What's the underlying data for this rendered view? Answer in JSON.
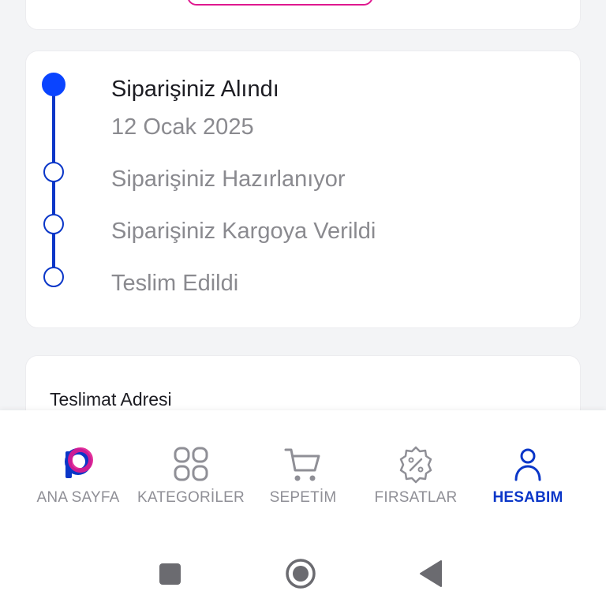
{
  "order_status": {
    "steps": [
      {
        "label": "Siparişiniz Alındı",
        "date": "12 Ocak 2025",
        "active": true
      },
      {
        "label": "Siparişiniz Hazırlanıyor",
        "active": false
      },
      {
        "label": "Siparişiniz Kargoya Verildi",
        "active": false
      },
      {
        "label": "Teslim Edildi",
        "active": false
      }
    ]
  },
  "address": {
    "title": "Teslimat Adresi"
  },
  "bottom_nav": {
    "items": [
      {
        "label": "ANA SAYFA",
        "icon": "brand-logo-icon",
        "active": false
      },
      {
        "label": "KATEGORİLER",
        "icon": "grid-icon",
        "active": false
      },
      {
        "label": "SEPETİM",
        "icon": "cart-icon",
        "active": false
      },
      {
        "label": "FIRSATLAR",
        "icon": "discount-badge-icon",
        "active": false
      },
      {
        "label": "HESABIM",
        "icon": "user-icon",
        "active": true
      }
    ]
  },
  "system_nav": {
    "buttons": [
      "recents-icon",
      "home-icon",
      "back-icon"
    ]
  },
  "colors": {
    "primary": "#0a36c8",
    "active_dot": "#0a44ff",
    "brand_pink": "#e0198f",
    "muted_text": "#8a8a8f"
  }
}
